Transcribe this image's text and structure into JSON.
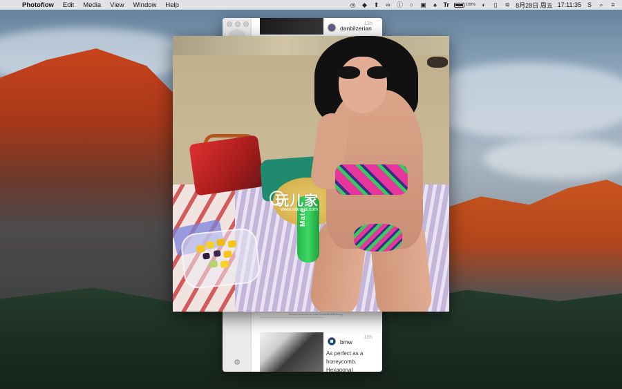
{
  "menubar": {
    "app_name": "Photoflow",
    "menus": [
      "Edit",
      "Media",
      "View",
      "Window",
      "Help"
    ],
    "status": {
      "battery_label": "100%",
      "battery_level": 1.0,
      "input_method": "Tr",
      "date": "8月28日 周五",
      "time": "17:11:35"
    }
  },
  "photoflow": {
    "posts": [
      {
        "username": "danbilzerian",
        "time": "13h"
      },
      {
        "username": "bmw",
        "time": "18h",
        "caption": "As perfect as a honeycomb. Hexagonal"
      }
    ],
    "strip_caption": "breezy seasons as lead Ocularlia adipiscing"
  },
  "viewer": {
    "bottle_label": "Mate",
    "watermark": {
      "text": "玩儿家",
      "url": "www.wanrjia.com"
    }
  }
}
